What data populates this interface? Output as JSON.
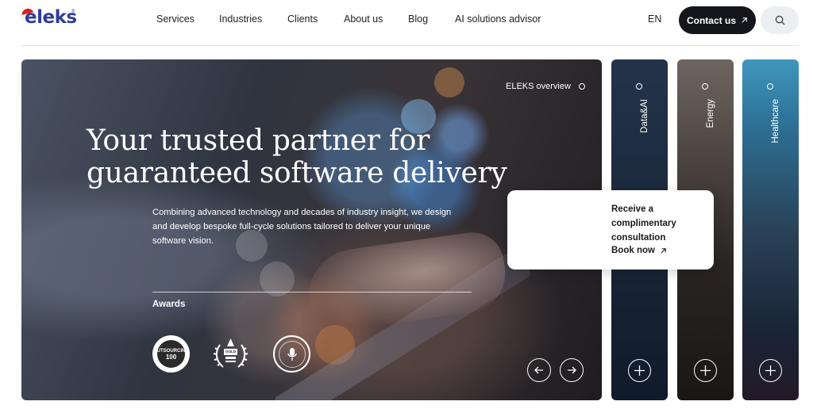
{
  "header": {
    "logo_text": "eleks",
    "logo_reg": "®",
    "nav": [
      {
        "label": "Services"
      },
      {
        "label": "Industries"
      },
      {
        "label": "Clients"
      },
      {
        "label": "About us"
      },
      {
        "label": "Blog"
      },
      {
        "label": "AI solutions advisor"
      }
    ],
    "language": "EN",
    "contact_label": "Contact us",
    "contact_icon": "arrow-up-right-icon",
    "search_icon": "search-icon"
  },
  "hero": {
    "overview_label": "ELEKS overview",
    "title_line1": "Your trusted partner for",
    "title_line2": "guaranteed software delivery",
    "description": "Combining advanced technology and decades of industry insight, we design and develop bespoke full-cycle solutions tailored to deliver your unique software vision.",
    "awards_label": "Awards",
    "award_1_text": [
      "OUTSOURCING",
      "100"
    ],
    "award_2_text": "GOLD",
    "prev_icon": "arrow-left-icon",
    "next_icon": "arrow-right-icon"
  },
  "cards": [
    {
      "label": "Data&AI",
      "color": "#1c2a3e"
    },
    {
      "label": "Energy",
      "color": "#4b433f"
    },
    {
      "label": "Healthcare",
      "color": "#2d6f94"
    }
  ],
  "popup": {
    "line1": "Receive a",
    "line2": "complimentary",
    "line3": "consultation",
    "link_label": "Book now"
  },
  "colors": {
    "brand": "#2f3d97",
    "logo_hat": "#d92020",
    "contact_bg": "#15161c",
    "search_bg": "#eceef1"
  }
}
